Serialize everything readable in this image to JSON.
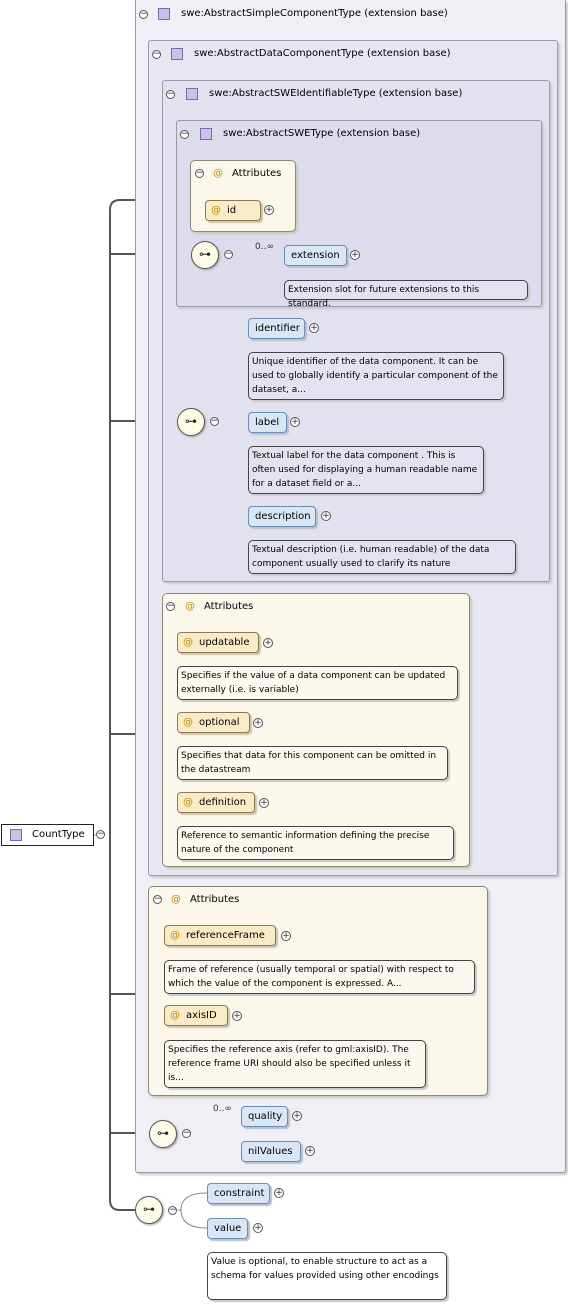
{
  "root": {
    "label": "CountType"
  },
  "types": {
    "abstract_simple": "swe:AbstractSimpleComponentType (extension base)",
    "abstract_data": "swe:AbstractDataComponentType (extension base)",
    "abstract_identifiable": "swe:AbstractSWEIdentifiableType (extension base)",
    "abstract_swe": "swe:AbstractSWEType (extension base)"
  },
  "attributes_header": "Attributes",
  "at_symbol": "@",
  "swe_type": {
    "attr_id": "id",
    "multiplicity": "0..∞",
    "extension": "extension",
    "extension_doc": "Extension slot for future extensions to this standard."
  },
  "identifiable": {
    "identifier": "identifier",
    "identifier_doc": "Unique identifier of the data component. It can be used to globally identify a particular component of the dataset, a...",
    "label": "label",
    "label_doc": "Textual label for the data component . This is often used for displaying a human readable name for a dataset field or a...",
    "description": "description",
    "description_doc": "Textual description (i.e. human readable) of the data component usually used to clarify its nature"
  },
  "data_attributes": {
    "updatable": "updatable",
    "updatable_doc": "Specifies if the value of a data component can be updated externally (i.e. is variable)",
    "optional": "optional",
    "optional_doc": "Specifies that data for this component can be omitted in the datastream",
    "definition": "definition",
    "definition_doc": "Reference to semantic information defining the precise nature of the component"
  },
  "simple_attributes": {
    "referenceFrame": "referenceFrame",
    "referenceFrame_doc": "Frame of reference (usually temporal or spatial) with respect to which the value of the component is expressed. A...",
    "axisID": "axisID",
    "axisID_doc": "Specifies the reference axis (refer to gml:axisID). The reference frame URI should also be specified unless it is..."
  },
  "simple_elements": {
    "multiplicity": "0..∞",
    "quality": "quality",
    "nilValues": "nilValues"
  },
  "count_elements": {
    "constraint": "constraint",
    "value": "value",
    "value_doc": "Value is optional, to enable structure to act as a schema for values provided using other encodings"
  },
  "symbols": {
    "minus": "−",
    "plus": "+",
    "sequence": "⊶"
  }
}
